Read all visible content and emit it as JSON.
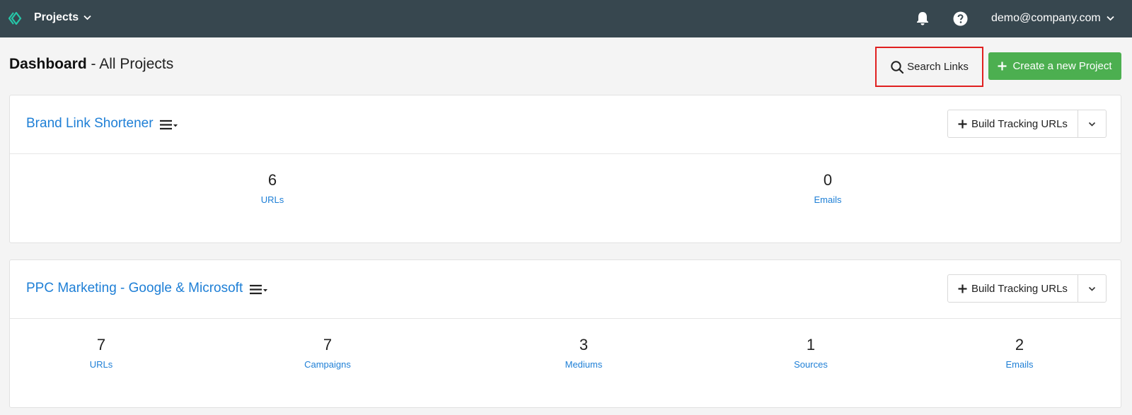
{
  "topbar": {
    "projects_label": "Projects",
    "user_label": "demo@company.com"
  },
  "page": {
    "title_strong": "Dashboard",
    "title_sep": " - ",
    "title_rest": "All Projects"
  },
  "actions": {
    "search_label": "Search Links",
    "create_label": "Create a new Project"
  },
  "colors": {
    "topbar": "#37474f",
    "accent_link": "#1e7fd6",
    "create_green": "#4caf50",
    "highlight_red": "#e02020"
  },
  "projects": [
    {
      "name": "Brand Link Shortener",
      "build_label": "Build Tracking URLs",
      "stats": [
        {
          "value": "6",
          "label": "URLs"
        },
        {
          "value": "0",
          "label": "Emails"
        }
      ]
    },
    {
      "name": "PPC Marketing - Google & Microsoft",
      "build_label": "Build Tracking URLs",
      "stats": [
        {
          "value": "7",
          "label": "URLs"
        },
        {
          "value": "7",
          "label": "Campaigns"
        },
        {
          "value": "3",
          "label": "Mediums"
        },
        {
          "value": "1",
          "label": "Sources"
        },
        {
          "value": "2",
          "label": "Emails"
        }
      ]
    }
  ]
}
